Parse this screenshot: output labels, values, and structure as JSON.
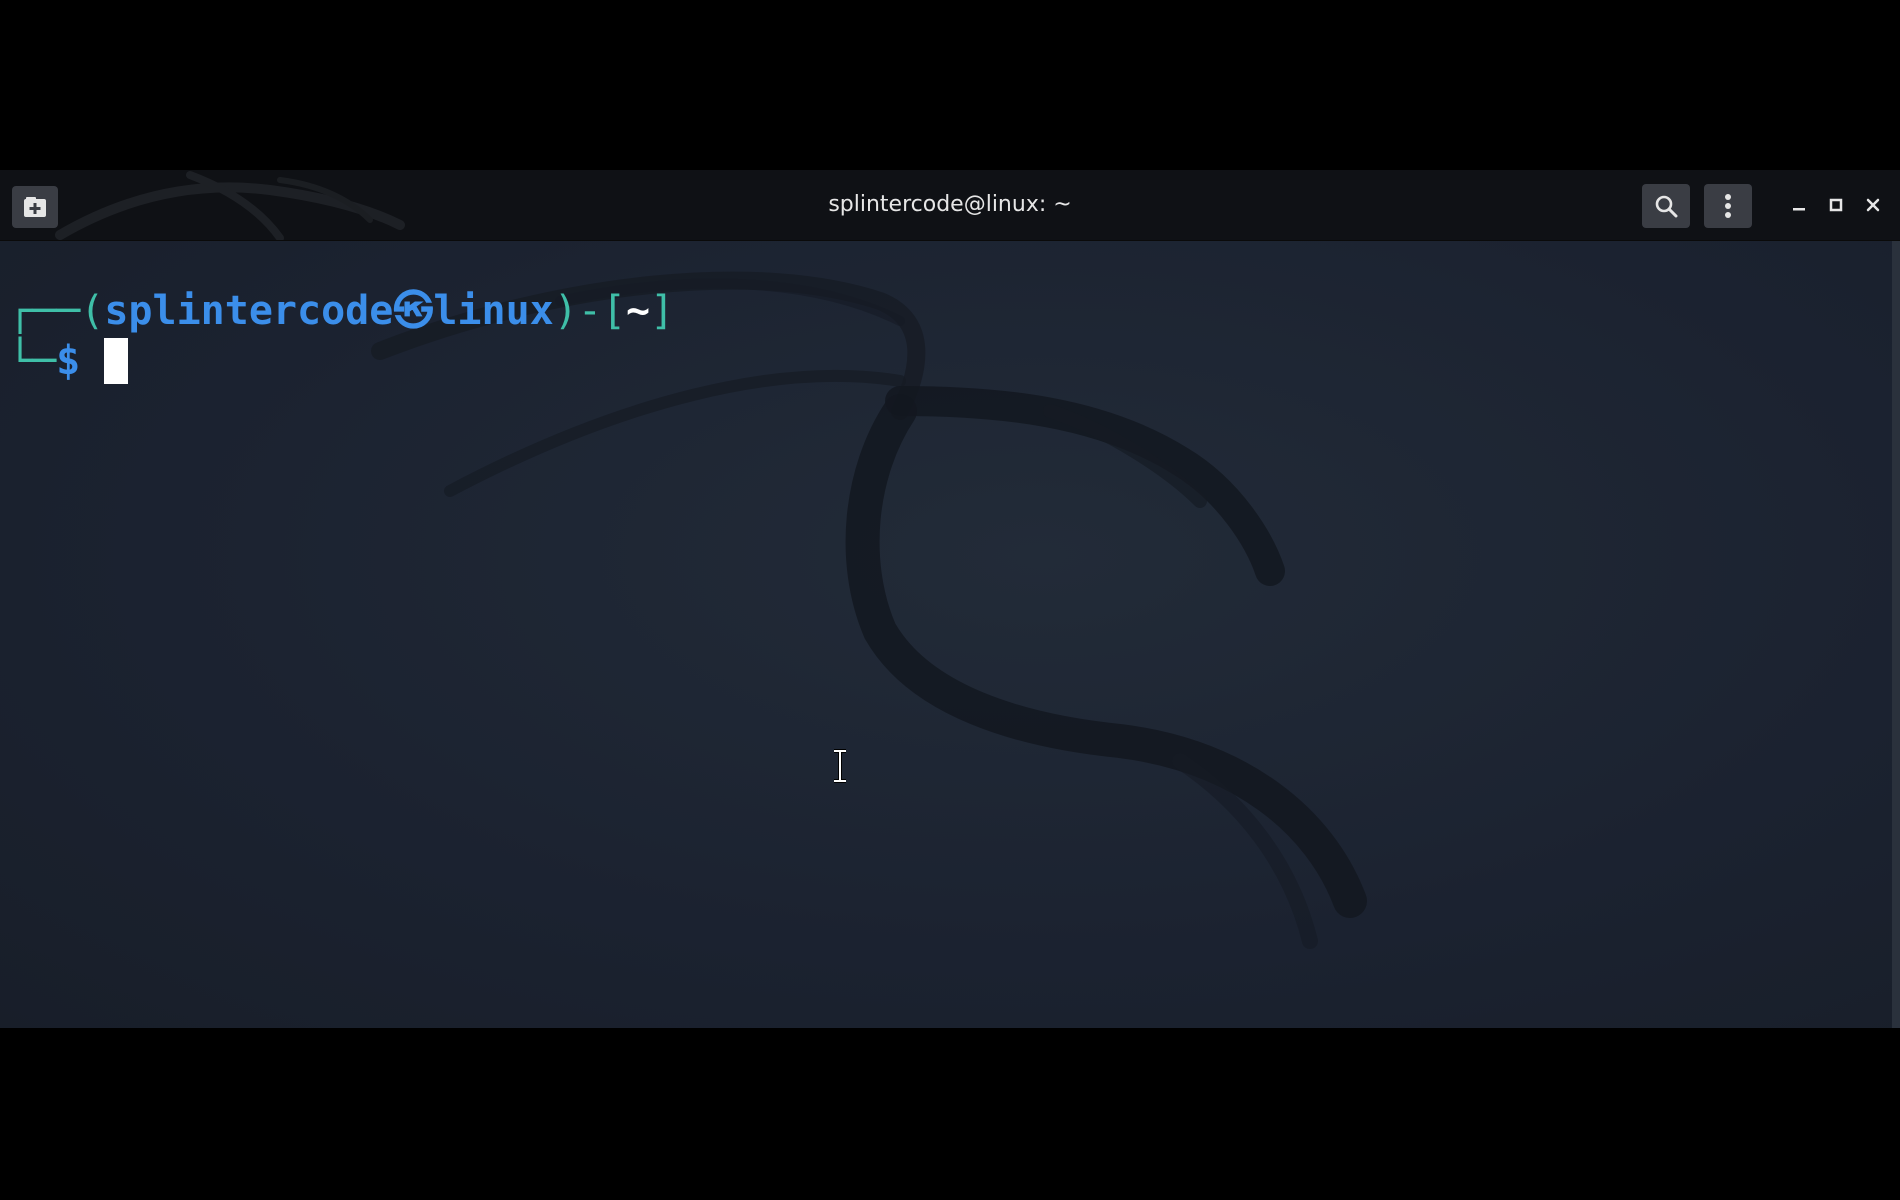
{
  "window": {
    "title": "splintercode@linux: ~"
  },
  "titlebar": {
    "new_tab_icon": "new-tab-icon",
    "search_icon": "search-icon",
    "menu_icon": "kebab-menu-icon",
    "minimize_icon": "minimize-icon",
    "maximize_icon": "maximize-icon",
    "close_icon": "close-icon"
  },
  "prompt": {
    "corner_top": "┌──",
    "open_paren": "(",
    "user": "splintercode",
    "separator_symbol": "㉿",
    "host": "linux",
    "close_paren": ")",
    "dash": "-",
    "open_bracket": "[",
    "cwd": "~",
    "close_bracket": "]",
    "corner_bottom": "└─",
    "dollar": "$",
    "input": ""
  },
  "colors": {
    "frame_teal": "#3fbfa8",
    "user_host_blue": "#3b8eea",
    "background": "#1c2330",
    "titlebar": "#0f1115"
  }
}
